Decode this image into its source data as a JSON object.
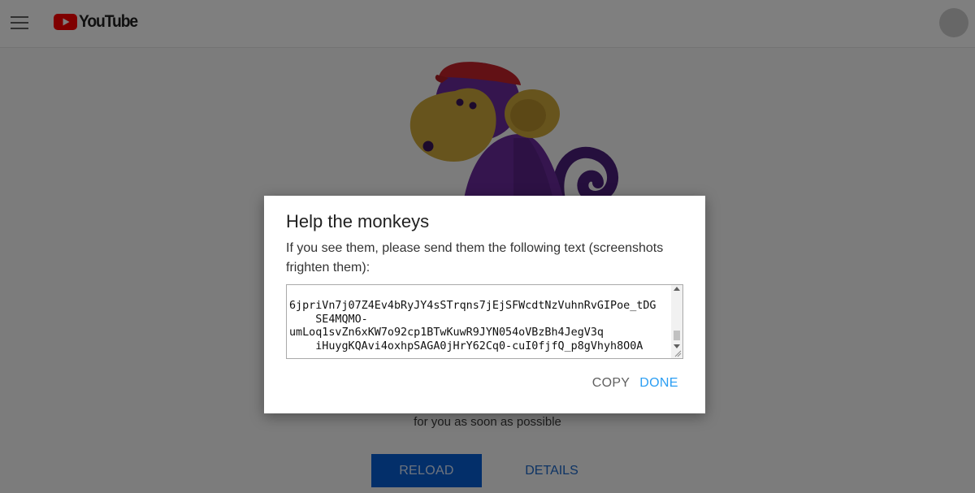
{
  "header": {
    "menu_icon": "hamburger-menu-icon",
    "logo_icon": "youtube-play-icon",
    "logo_text": "YouTube",
    "avatar": "avatar-placeholder"
  },
  "background": {
    "illustration": "monkey-with-red-cap",
    "message": "for you as soon as possible",
    "reload_label": "RELOAD",
    "details_label": "DETAILS"
  },
  "dialog": {
    "title": "Help the monkeys",
    "description": "If you see them, please send them the following text (screenshots frighten them):",
    "textarea": {
      "lines": [
        "6jpriVn7j07Z4Ev4bRyJY4sSTrqns7jEjSFWcdtNzVuhnRvGIPoe_tDG",
        "    SE4MQMO-",
        "umLoq1svZn6xKW7o92cp1BTwKuwR9JYN054oVBzBh4JegV3q",
        "    iHuygKQAvi4oxhpSAGA0jHrY62Cq0-cuI0fjfQ_p8gVhyh8O0A"
      ]
    },
    "copy_label": "COPY",
    "done_label": "DONE"
  },
  "colors": {
    "youtube_red": "#ff0000",
    "reload_blue": "#065fd4",
    "done_blue": "#2b9ef3",
    "cap_red": "#c4222a",
    "monkey_purple": "#6a2a9d",
    "monkey_face": "#cfa83a"
  }
}
